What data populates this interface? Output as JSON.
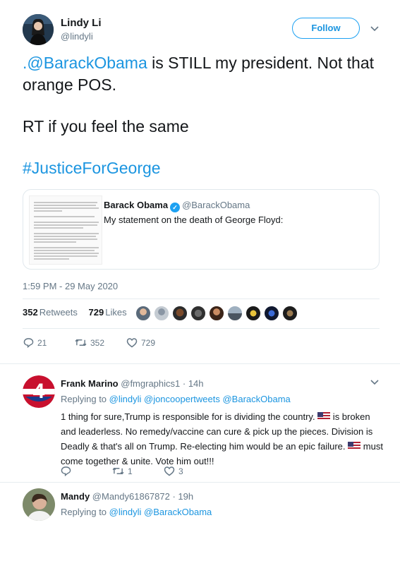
{
  "author": {
    "name": "Lindy Li",
    "handle": "@lindyli",
    "follow_label": "Follow"
  },
  "tweet": {
    "mention": ".@BarackObama",
    "line1_rest": " is STILL my president. Not that orange POS.",
    "line2": "RT if you feel the same",
    "hashtag": "#JusticeForGeorge",
    "timestamp": "1:59 PM - 29 May 2020"
  },
  "quote": {
    "name": "Barack Obama",
    "handle": "@BarackObama",
    "text": "My statement on the death of George Floyd:",
    "verified_icon": "verified-badge-icon"
  },
  "stats": {
    "retweets_count": "352",
    "retweets_label": "Retweets",
    "likes_count": "729",
    "likes_label": "Likes"
  },
  "actions": {
    "replies": "21",
    "retweets": "352",
    "likes": "729"
  },
  "replies": [
    {
      "name": "Frank Marino",
      "handle": "@fmgraphics1",
      "time": "· 14h",
      "replying_prefix": "Replying to",
      "replying_to": "@lindyli @joncoopertweets @BarackObama",
      "text_part1": "1 thing for sure,Trump is responsible for is dividing the country.",
      "text_part2": " is broken and leaderless. No remedy/vaccine can cure & pick up the pieces. Division is Deadly & that's all on Trump. Re-electing him would be an epic failure.",
      "text_part3": " must come together & unite. Vote him out!!!",
      "reply_count": "",
      "retweet_count": "1",
      "like_count": "3"
    },
    {
      "name": "Mandy",
      "handle": "@Mandy61867872",
      "time": "· 19h",
      "replying_prefix": "Replying to",
      "replying_to": "@lindyli @BarackObama"
    }
  ],
  "colors": {
    "link_blue": "#1b95e0",
    "secondary_text": "#657786",
    "divider": "#e6ecf0"
  }
}
